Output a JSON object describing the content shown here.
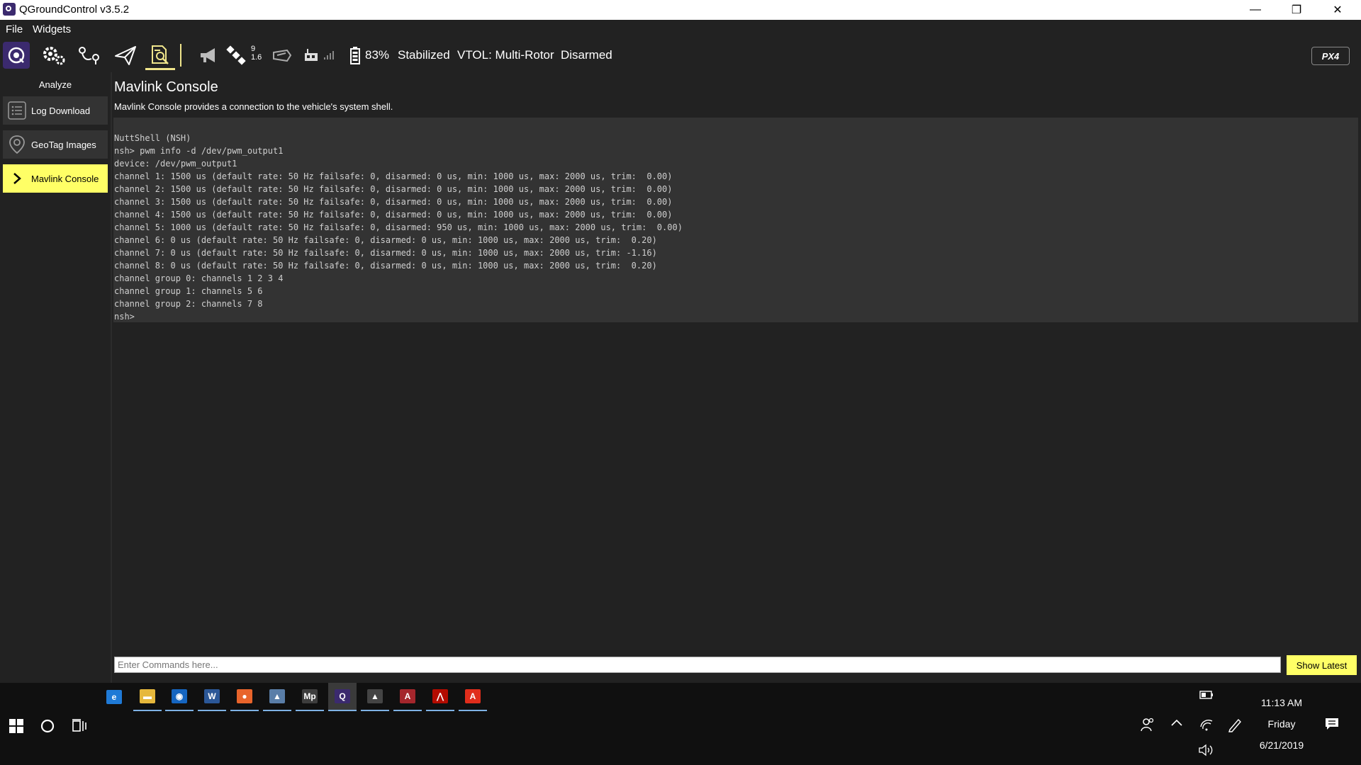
{
  "window": {
    "title": "QGroundControl v3.5.2",
    "minimize": "—",
    "restore": "❐",
    "close": "✕"
  },
  "menu": {
    "items": [
      "File",
      "Widgets"
    ]
  },
  "toolbar": {
    "satellites": "9",
    "hdop": "1.6",
    "battery": "83%",
    "flight_mode": "Stabilized",
    "vehicle_type": "VTOL: Multi-Rotor",
    "arm_state": "Disarmed",
    "logo": "PX4",
    "accent_color": "#f0e68c"
  },
  "sidebar": {
    "heading": "Analyze",
    "items": [
      {
        "label": "Log Download",
        "icon": "list-icon"
      },
      {
        "label": "GeoTag Images",
        "icon": "map-pin-icon"
      },
      {
        "label": "Mavlink Console",
        "icon": "chevron-right-icon",
        "selected": true
      }
    ]
  },
  "main": {
    "title": "Mavlink Console",
    "description": "Mavlink Console provides a connection to the vehicle's system shell.",
    "console_lines": [
      "NuttShell (NSH)",
      "nsh> pwm info -d /dev/pwm_output1",
      "device: /dev/pwm_output1",
      "channel 1: 1500 us (default rate: 50 Hz failsafe: 0, disarmed: 0 us, min: 1000 us, max: 2000 us, trim:  0.00)",
      "channel 2: 1500 us (default rate: 50 Hz failsafe: 0, disarmed: 0 us, min: 1000 us, max: 2000 us, trim:  0.00)",
      "channel 3: 1500 us (default rate: 50 Hz failsafe: 0, disarmed: 0 us, min: 1000 us, max: 2000 us, trim:  0.00)",
      "channel 4: 1500 us (default rate: 50 Hz failsafe: 0, disarmed: 0 us, min: 1000 us, max: 2000 us, trim:  0.00)",
      "channel 5: 1000 us (default rate: 50 Hz failsafe: 0, disarmed: 950 us, min: 1000 us, max: 2000 us, trim:  0.00)",
      "channel 6: 0 us (default rate: 50 Hz failsafe: 0, disarmed: 0 us, min: 1000 us, max: 2000 us, trim:  0.20)",
      "channel 7: 0 us (default rate: 50 Hz failsafe: 0, disarmed: 0 us, min: 1000 us, max: 2000 us, trim: -1.16)",
      "channel 8: 0 us (default rate: 50 Hz failsafe: 0, disarmed: 0 us, min: 1000 us, max: 2000 us, trim:  0.20)",
      "channel group 0: channels 1 2 3 4",
      "channel group 1: channels 5 6",
      "channel group 2: channels 7 8",
      "nsh>"
    ],
    "command_placeholder": "Enter Commands here...",
    "command_value": "",
    "show_latest_label": "Show Latest"
  },
  "taskbar": {
    "apps": [
      {
        "icon": "edge-icon",
        "glyph": "e",
        "color": "#1f7ad6",
        "running": false
      },
      {
        "icon": "file-explorer-icon",
        "glyph": "▬",
        "color": "#e6b83c",
        "running": true
      },
      {
        "icon": "outlook-icon",
        "glyph": "◉",
        "color": "#1565c0",
        "running": true
      },
      {
        "icon": "word-icon",
        "glyph": "W",
        "color": "#2b5797",
        "running": true
      },
      {
        "icon": "firefox-icon",
        "glyph": "●",
        "color": "#e8642b",
        "running": true
      },
      {
        "icon": "photos-app-icon",
        "glyph": "▲",
        "color": "#5a7ea8",
        "running": true
      },
      {
        "icon": "mission-planner-icon",
        "glyph": "Mp",
        "color": "#3d3d3d",
        "running": true
      },
      {
        "icon": "qgroundcontrol-icon",
        "glyph": "Q",
        "color": "#3b2a6e",
        "running": true,
        "active": true
      },
      {
        "icon": "image-viewer-icon",
        "glyph": "▲",
        "color": "#444444",
        "running": true
      },
      {
        "icon": "access-icon",
        "glyph": "A",
        "color": "#a4262c",
        "running": true
      },
      {
        "icon": "acrobat-reader-icon",
        "glyph": "⋀",
        "color": "#b30b00",
        "running": true
      },
      {
        "icon": "acrobat-icon",
        "glyph": "A",
        "color": "#e02d1b",
        "running": true
      }
    ],
    "clock": {
      "time": "11:13 AM",
      "day": "Friday",
      "date": "6/21/2019"
    }
  }
}
